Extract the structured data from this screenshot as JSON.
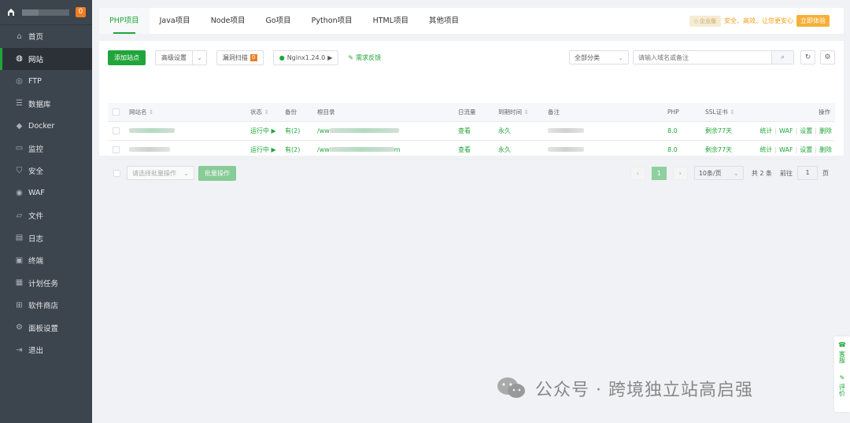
{
  "sidebar": {
    "badge": "0",
    "items": [
      {
        "label": "首页",
        "icon": "home-icon"
      },
      {
        "label": "网站",
        "icon": "globe-icon"
      },
      {
        "label": "FTP",
        "icon": "ftp-icon"
      },
      {
        "label": "数据库",
        "icon": "database-icon"
      },
      {
        "label": "Docker",
        "icon": "docker-icon"
      },
      {
        "label": "监控",
        "icon": "monitor-icon"
      },
      {
        "label": "安全",
        "icon": "shield-icon"
      },
      {
        "label": "WAF",
        "icon": "waf-icon"
      },
      {
        "label": "文件",
        "icon": "folder-icon"
      },
      {
        "label": "日志",
        "icon": "log-icon"
      },
      {
        "label": "终端",
        "icon": "terminal-icon"
      },
      {
        "label": "计划任务",
        "icon": "calendar-icon"
      },
      {
        "label": "软件商店",
        "icon": "grid-icon"
      },
      {
        "label": "面板设置",
        "icon": "gear-icon"
      },
      {
        "label": "退出",
        "icon": "logout-icon"
      }
    ]
  },
  "tabs": [
    "PHP项目",
    "Java项目",
    "Node项目",
    "Go项目",
    "Python项目",
    "HTML项目",
    "其他项目"
  ],
  "promo": {
    "edition": "企业版",
    "text": "安全、高效、让您更安心",
    "button": "立即体验"
  },
  "toolbar": {
    "add_site": "添加站点",
    "advanced": "高级设置",
    "vuln_scan": "漏洞扫描",
    "vuln_count": "0",
    "nginx": "Nginx1.24.0",
    "feedback": "需求反馈",
    "category": "全部分类",
    "search_placeholder": "请输入域名或备注"
  },
  "table": {
    "headers": {
      "name": "网站名",
      "status": "状态",
      "backup": "备份",
      "root": "根目录",
      "traffic": "日流量",
      "expire": "到期时间",
      "note": "备注",
      "php": "PHP",
      "ssl": "SSL证书",
      "ops": "操作"
    },
    "rows": [
      {
        "status": "运行中",
        "backup": "有(2)",
        "root_prefix": "/ww",
        "traffic": "查看",
        "expire": "永久",
        "php": "8.0",
        "ssl": "剩余77天",
        "op_stats": "统计",
        "op_waf": "WAF",
        "op_settings": "设置",
        "op_delete": "删除"
      },
      {
        "status": "运行中",
        "backup": "有(2)",
        "root_prefix": "/ww",
        "root_suffix": "m",
        "traffic": "查看",
        "expire": "永久",
        "php": "8.0",
        "ssl": "剩余77天",
        "op_stats": "统计",
        "op_waf": "WAF",
        "op_settings": "设置",
        "op_delete": "删除"
      }
    ]
  },
  "footer": {
    "batch_select": "请选择批量操作",
    "batch_button": "批量操作",
    "page": "1",
    "page_size": "10条/页",
    "total": "共 2 条",
    "goto_label": "前往",
    "goto_value": "1",
    "page_unit": "页"
  },
  "watermark": "公众号 · 跨境独立站高启强",
  "float": {
    "service": "客服",
    "review": "评价"
  },
  "colors": {
    "accent": "#20a53a",
    "sidebar_bg": "#3c444d",
    "warning": "#f39c12"
  }
}
